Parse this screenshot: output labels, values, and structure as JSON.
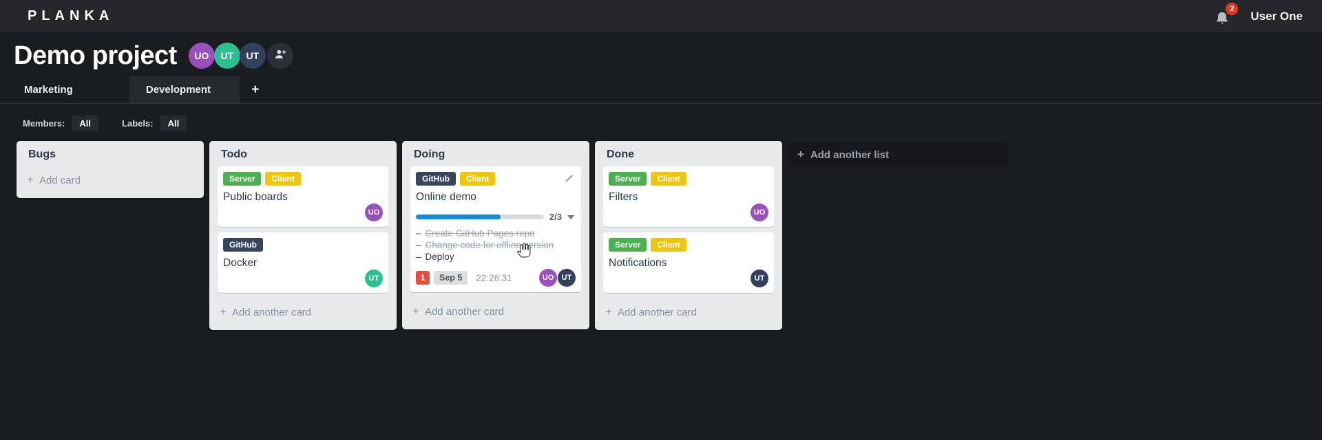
{
  "icons": {
    "plus": "+",
    "dash": "–"
  },
  "colors": {
    "accent_blue": "#1f87d8",
    "label_green": "#4caf50",
    "label_yellow": "#eec60e",
    "label_navy": "#36445c",
    "avatar_purple": "#9a50bb",
    "avatar_teal": "#2dbe92",
    "avatar_navy": "#32405a",
    "badge_red": "#e74c3c",
    "notification_red": "#dd3a23"
  },
  "topbar": {
    "logo": "PLANKA",
    "notification_count": "2",
    "user_name": "User One"
  },
  "project": {
    "title": "Demo project",
    "members": [
      {
        "initials": "UO",
        "color": "#9a50bb"
      },
      {
        "initials": "UT",
        "color": "#2dbe92"
      },
      {
        "initials": "UT",
        "color": "#32405a"
      }
    ]
  },
  "tabs": {
    "items": [
      {
        "label": "Marketing",
        "active": false
      },
      {
        "label": "Development",
        "active": true
      }
    ]
  },
  "filters": {
    "members_label": "Members:",
    "members_value": "All",
    "labels_label": "Labels:",
    "labels_value": "All"
  },
  "board": {
    "add_list_label": "Add another list",
    "lists": [
      {
        "title": "Bugs",
        "add_card_label": "Add card",
        "cards": []
      },
      {
        "title": "Todo",
        "add_card_label": "Add another card",
        "cards": [
          {
            "title": "Public boards",
            "labels": [
              {
                "text": "Server",
                "color": "#4caf50"
              },
              {
                "text": "Client",
                "color": "#eec60e"
              }
            ],
            "members": [
              {
                "initials": "UO",
                "color": "#9a50bb"
              }
            ]
          },
          {
            "title": "Docker",
            "labels": [
              {
                "text": "GitHub",
                "color": "#36445c"
              }
            ],
            "members": [
              {
                "initials": "UT",
                "color": "#2dbe92"
              }
            ]
          }
        ]
      },
      {
        "title": "Doing",
        "add_card_label": "Add another card",
        "cards": [
          {
            "title": "Online demo",
            "labels": [
              {
                "text": "GitHub",
                "color": "#36445c"
              },
              {
                "text": "Client",
                "color": "#eec60e"
              }
            ],
            "progress": {
              "percent": "66%",
              "text": "2/3",
              "color": "#1f87d8"
            },
            "tasks": [
              {
                "text": "Create GitHub Pages repo",
                "done": true
              },
              {
                "text": "Change code for offline version",
                "done": true
              },
              {
                "text": "Deploy",
                "done": false
              }
            ],
            "notification_count": "1",
            "due_date": "Sep 5",
            "timer": "22:26:31",
            "members": [
              {
                "initials": "UO",
                "color": "#9a50bb"
              },
              {
                "initials": "UT",
                "color": "#32405a"
              }
            ]
          }
        ]
      },
      {
        "title": "Done",
        "add_card_label": "Add another card",
        "cards": [
          {
            "title": "Filters",
            "labels": [
              {
                "text": "Server",
                "color": "#4caf50"
              },
              {
                "text": "Client",
                "color": "#eec60e"
              }
            ],
            "members": [
              {
                "initials": "UO",
                "color": "#9a50bb"
              }
            ]
          },
          {
            "title": "Notifications",
            "labels": [
              {
                "text": "Server",
                "color": "#4caf50"
              },
              {
                "text": "Client",
                "color": "#eec60e"
              }
            ],
            "members": [
              {
                "initials": "UT",
                "color": "#32405a"
              }
            ]
          }
        ]
      }
    ]
  }
}
